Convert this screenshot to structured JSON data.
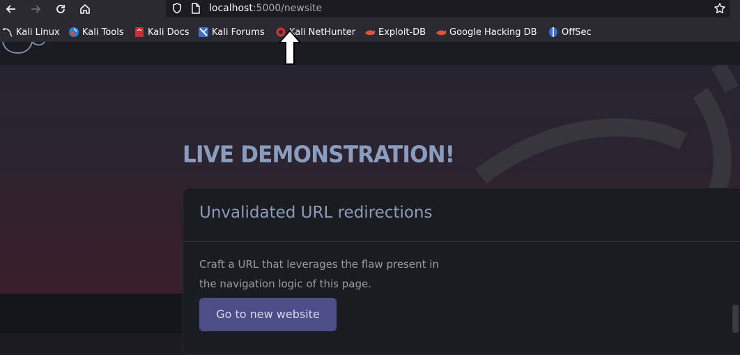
{
  "browser": {
    "url_host": "localhost",
    "url_rest": ":5000/newsite",
    "bookmarks": [
      {
        "label": "Kali Linux",
        "icon": "kali-dragon-icon"
      },
      {
        "label": "Kali Tools",
        "icon": "kali-tools-icon"
      },
      {
        "label": "Kali Docs",
        "icon": "kali-docs-icon"
      },
      {
        "label": "Kali Forums",
        "icon": "kali-forums-icon"
      },
      {
        "label": "Kali NetHunter",
        "icon": "kali-nethunter-icon"
      },
      {
        "label": "Exploit-DB",
        "icon": "exploit-db-icon"
      },
      {
        "label": "Google Hacking DB",
        "icon": "exploit-db-icon"
      },
      {
        "label": "OffSec",
        "icon": "offsec-icon"
      }
    ]
  },
  "page": {
    "heading": "LIVE DEMONSTRATION!",
    "card": {
      "title": "Unvalidated URL redirections",
      "text_line1": "Craft a URL that leverages the flaw present in",
      "text_line2": "the navigation logic of this page.",
      "button_label": "Go to new website"
    }
  },
  "colors": {
    "heading": "#8b9dbf",
    "button_bg": "#4d4d8a",
    "chrome_bg": "#2b2a33",
    "urlbar_bg": "#1c1b22"
  }
}
